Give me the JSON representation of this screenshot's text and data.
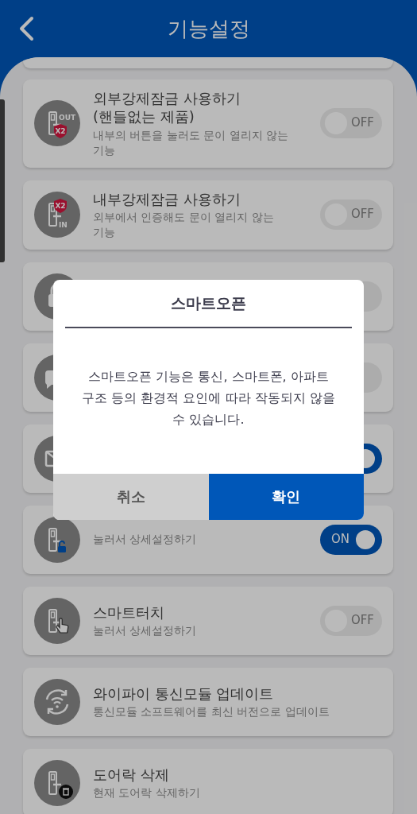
{
  "header": {
    "title": "기능설정"
  },
  "settings": [
    {
      "kind": "stub"
    },
    {
      "kind": "toggle",
      "icon_labels": [
        "OUT",
        "X2"
      ],
      "title": "외부강제잠금 사용하기\n(핸들없는 제품)",
      "subtitle": "내부의 버튼을 눌러도 문이 열리지 않는\n기능",
      "on": false,
      "toggle_label": "OFF"
    },
    {
      "kind": "toggle",
      "icon_labels": [
        "X2",
        "IN"
      ],
      "title": "내부강제잠금 사용하기",
      "subtitle": "외부에서 인증해도 문이 열리지 않는\n기능",
      "on": false,
      "toggle_label": "OFF"
    },
    {
      "kind": "toggle",
      "on": false
    },
    {
      "kind": "toggle",
      "on": false
    },
    {
      "kind": "toggle",
      "on": true
    },
    {
      "kind": "toggle",
      "subtitle": "눌러서 상세설정하기",
      "on": true,
      "toggle_label": "ON"
    },
    {
      "kind": "toggle",
      "title": "스마트터치",
      "subtitle": "눌러서 상세설정하기",
      "on": false,
      "toggle_label": "OFF"
    },
    {
      "kind": "action",
      "title": "와이파이 통신모듈 업데이트",
      "subtitle": "통신모듈 소프트웨어를 최신 버전으로 업데이트"
    },
    {
      "kind": "action",
      "title": "도어락 삭제",
      "subtitle": "현재 도어락 삭제하기"
    }
  ],
  "dialog": {
    "title": "스마트오픈",
    "message": "스마트오픈 기능은 통신, 스마트폰, 아파트\n구조 등의 환경적 요인에 따라 작동되지 않을\n수 있습니다.",
    "buttons": [
      {
        "kind": "cancel",
        "label": "취소"
      },
      {
        "kind": "confirm",
        "label": "확인"
      }
    ]
  }
}
